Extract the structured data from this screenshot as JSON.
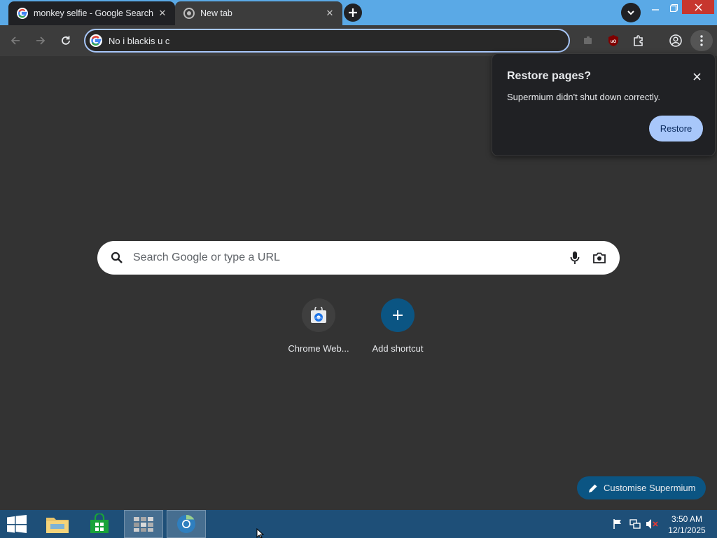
{
  "browser": {
    "tabs": [
      {
        "title": "monkey selfie - Google Search",
        "favicon": "google-g-icon",
        "active": false
      },
      {
        "title": "New tab",
        "favicon": "chrome-icon",
        "active": true
      }
    ],
    "new_tab_icon": "plus-icon",
    "tab_search_icon": "chevron-down-icon",
    "window_controls": [
      "minimize-icon",
      "restore-icon",
      "close-icon"
    ]
  },
  "toolbar": {
    "back_icon": "arrow-left-icon",
    "forward_icon": "arrow-right-icon",
    "reload_icon": "reload-icon",
    "omnibox_text": "No i blackis u c",
    "extensions": [
      "extension-puzzle-gray-icon",
      "ublock-origin-icon",
      "extensions-puzzle-icon"
    ],
    "profile_icon": "profile-icon",
    "menu_icon": "kebab-menu-icon"
  },
  "ntp": {
    "search_placeholder": "Search Google or type a URL",
    "shortcuts": [
      {
        "label": "Chrome Web...",
        "icon": "chrome-web-store-icon"
      },
      {
        "label": "Add shortcut",
        "icon": "plus-icon"
      }
    ],
    "customise_label": "Customise Supermium"
  },
  "restore_popup": {
    "title": "Restore pages?",
    "body": "Supermium didn't shut down correctly.",
    "button": "Restore"
  },
  "taskbar": {
    "items": [
      "start-windows-icon",
      "file-explorer-icon",
      "store-icon",
      "app-grid-icon",
      "supermium-browser-icon"
    ],
    "tray": [
      "flag-icon",
      "network-icon",
      "volume-muted-icon"
    ],
    "time": "3:50 AM",
    "date": "12/1/2025"
  },
  "colors": {
    "tabstrip": "#5aa9e6",
    "toolbar": "#3c3c3c",
    "page_bg": "#333333",
    "accent": "#a8c7fa",
    "customise_bg": "#0b5583",
    "taskbar": "#1e4f78"
  }
}
